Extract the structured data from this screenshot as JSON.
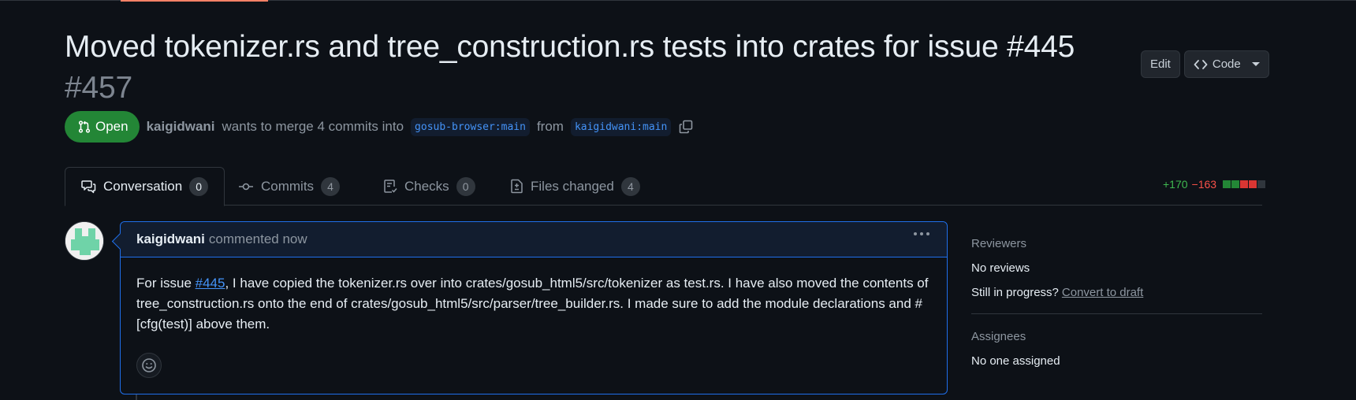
{
  "pr": {
    "title": "Moved tokenizer.rs and tree_construction.rs tests into crates for issue #445",
    "number": "#457",
    "state": "Open",
    "author": "kaigidwani",
    "merge_text": "wants to merge 4 commits into",
    "base_branch": "gosub-browser:main",
    "from_text": "from",
    "head_branch": "kaigidwani:main"
  },
  "header_actions": {
    "edit_label": "Edit",
    "code_label": "Code"
  },
  "tabs": [
    {
      "label": "Conversation",
      "count": "0",
      "icon": "comment-discussion-icon",
      "active": true
    },
    {
      "label": "Commits",
      "count": "4",
      "icon": "git-commit-icon"
    },
    {
      "label": "Checks",
      "count": "0",
      "icon": "checklist-icon"
    },
    {
      "label": "Files changed",
      "count": "4",
      "icon": "file-diff-icon"
    }
  ],
  "diffstat": {
    "additions": "+170",
    "deletions": "−163",
    "blocks": [
      "#238636",
      "#238636",
      "#da3633",
      "#da3633",
      "#30363d"
    ]
  },
  "comment": {
    "author": "kaigidwani",
    "action": "commented now",
    "body_prefix": "For issue ",
    "issue_link": "#445",
    "body_rest": ", I have copied the tokenizer.rs over into crates/gosub_html5/src/tokenizer as test.rs. I have also moved the contents of tree_construction.rs onto the end of crates/gosub_html5/src/parser/tree_builder.rs. I made sure to add the module declarations and #[cfg(test)] above them."
  },
  "sidebar": {
    "reviewers": {
      "heading": "Reviewers",
      "value": "No reviews",
      "progress_text": "Still in progress?",
      "draft_link": "Convert to draft"
    },
    "assignees": {
      "heading": "Assignees",
      "value": "No one assigned"
    }
  },
  "colors": {
    "background": "#0d1117",
    "open_green": "#238636",
    "accent_blue": "#1f6feb",
    "link_blue": "#4493f8",
    "additions": "#3fb950",
    "deletions": "#f85149"
  }
}
